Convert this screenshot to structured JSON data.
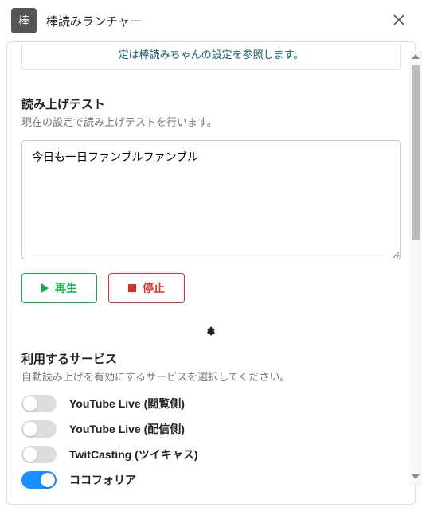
{
  "titlebar": {
    "icon_label": "棒",
    "title": "棒読みランチャー"
  },
  "info_box": {
    "text": "定は棒読みちゃんの設定を参照します。"
  },
  "readtest": {
    "title": "読み上げテスト",
    "desc": "現在の設定で読み上げテストを行います。",
    "value": "今日も一日ファンブルファンブル",
    "play_label": "再生",
    "stop_label": "停止"
  },
  "services": {
    "title": "利用するサービス",
    "desc": "自動読み上げを有効にするサービスを選択してください。",
    "items": [
      {
        "label": "YouTube Live (閲覧側)",
        "enabled": false
      },
      {
        "label": "YouTube Live (配信側)",
        "enabled": false
      },
      {
        "label": "TwitCasting (ツイキャス)",
        "enabled": false
      },
      {
        "label": "ココフォリア",
        "enabled": true
      }
    ]
  }
}
